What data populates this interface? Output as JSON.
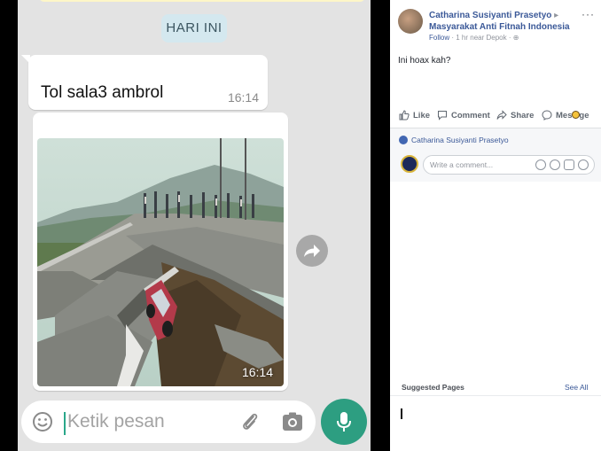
{
  "whatsapp": {
    "date_chip": "HARI INI",
    "messages": [
      {
        "text": "Tol sala3 ambrol",
        "time": "16:14"
      },
      {
        "type": "image",
        "time": "16:14"
      }
    ],
    "composer": {
      "placeholder": "Ketik pesan"
    },
    "icons": {
      "emoji": "emoji-icon",
      "attach": "paperclip-icon",
      "camera": "camera-icon",
      "mic": "mic-icon",
      "forward": "forward-icon"
    },
    "colors": {
      "background": "#e3e3e3",
      "accent": "#2d9e81",
      "date_chip": "#d4e8ef"
    }
  },
  "facebook": {
    "poster_name": "Catharina Susiyanti Prasetyo",
    "arrow": "▸",
    "group": "Masyarakat Anti Fitnah Indonesia",
    "follow": "Follow",
    "meta": " · 1 hr near Depok · ",
    "more": "···",
    "post_text": "Ini hoax kah?",
    "actions": {
      "like": "Like",
      "comment": "Comment",
      "share": "Share",
      "message": "Mes   ge"
    },
    "liker": "Catharina Susiyanti Prasetyo",
    "comment_placeholder": "Write a comment...",
    "suggested_pages": "Suggested Pages",
    "see_all": "See All",
    "colors": {
      "link": "#3b5998",
      "like_badge": "#4267b2"
    }
  }
}
